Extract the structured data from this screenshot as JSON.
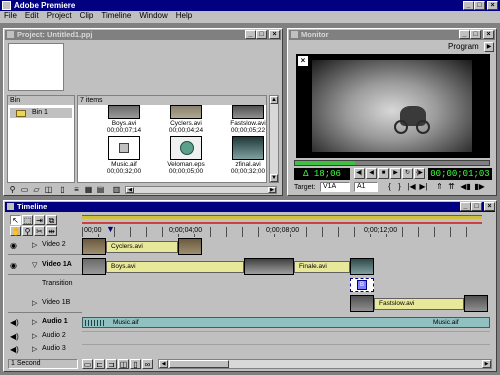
{
  "app": {
    "title": "Adobe Premiere"
  },
  "menu": [
    "File",
    "Edit",
    "Project",
    "Clip",
    "Timeline",
    "Window",
    "Help"
  ],
  "project": {
    "title": "Project: Untitled1.ppj",
    "bin_header": "Bin",
    "items_header": "7 items",
    "bins": [
      "Bin 1"
    ],
    "clips": [
      {
        "name": "Boys.avi",
        "duration": "00;00;07;14",
        "kind": "video"
      },
      {
        "name": "Cyclers.avi",
        "duration": "00;00;04;24",
        "kind": "video"
      },
      {
        "name": "Fastslow.avi",
        "duration": "00;00;05;22",
        "kind": "video"
      },
      {
        "name": "Music.aif",
        "duration": "00;00;32;00",
        "kind": "audio"
      },
      {
        "name": "Veloman.eps",
        "duration": "00;00;05;00",
        "kind": "still"
      },
      {
        "name": "zfinal.avi",
        "duration": "00;00;32;00",
        "kind": "video"
      }
    ]
  },
  "monitor": {
    "title": "Monitor",
    "view": "Program",
    "duration": "Δ 18;06",
    "timecode": "00;00;01;03",
    "target_label": "Target:",
    "target_video": "V1A",
    "target_audio": "A1"
  },
  "timeline": {
    "title": "Timeline",
    "ruler": [
      "00;00",
      "0;00;04;00",
      "0;00;08;00",
      "0;00;12;00"
    ],
    "tracks": [
      {
        "name": "Video 2",
        "clips": [
          "Cyclers.avi"
        ]
      },
      {
        "name": "Video 1A",
        "clips": [
          "Boys.avi",
          "Finale.avi"
        ]
      },
      {
        "name": "Transition",
        "clips": []
      },
      {
        "name": "Video 1B",
        "clips": [
          "Fastslow.avi"
        ]
      },
      {
        "name": "Audio 1",
        "clips": [
          "Music.aif",
          "Music.aif"
        ]
      },
      {
        "name": "Audio 2",
        "clips": []
      },
      {
        "name": "Audio 3",
        "clips": []
      }
    ],
    "zoom": "1 Second"
  },
  "colors": {
    "title_active": "#000080",
    "title_inactive": "#808080",
    "clip_yellow": "#e8e89a",
    "timecode_green": "#40ff40",
    "chrome": "#c0c0c0"
  }
}
